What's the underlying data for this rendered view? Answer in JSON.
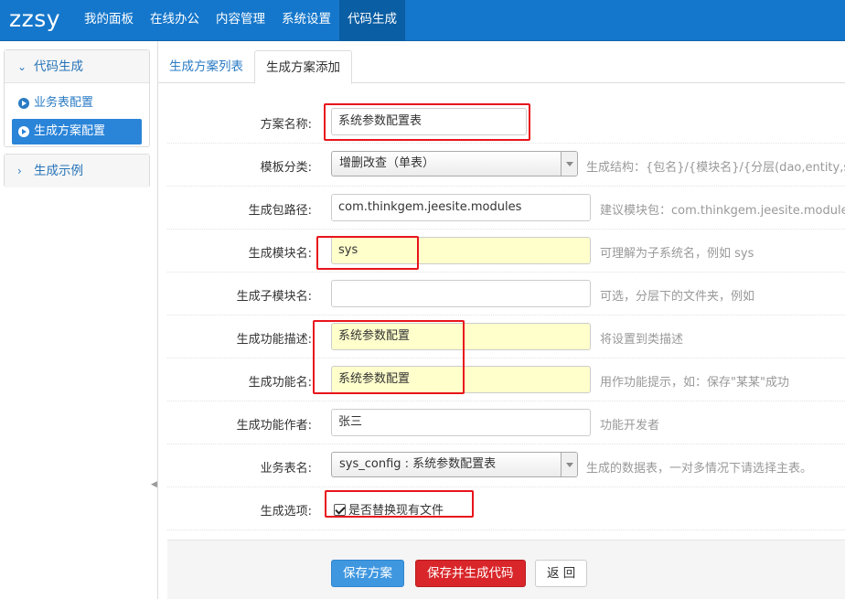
{
  "brand": "zzsy",
  "nav": [
    "我的面板",
    "在线办公",
    "内容管理",
    "系统设置",
    "代码生成"
  ],
  "sidebar": {
    "group1_title": "代码生成",
    "items": [
      "业务表配置",
      "生成方案配置"
    ],
    "group2_title": "生成示例"
  },
  "tabs": [
    "生成方案列表",
    "生成方案添加"
  ],
  "form": {
    "scheme_name": {
      "label": "方案名称:",
      "value": "系统参数配置表"
    },
    "template": {
      "label": "模板分类:",
      "value": "增删改查（单表）",
      "help": "生成结构：{包名}/{模块名}/{分层(dao,entity,service"
    },
    "package": {
      "label": "生成包路径:",
      "value": "com.thinkgem.jeesite.modules",
      "help": "建议模块包：com.thinkgem.jeesite.modules"
    },
    "module": {
      "label": "生成模块名:",
      "value": "sys",
      "help": "可理解为子系统名，例如 sys"
    },
    "sub_module": {
      "label": "生成子模块名:",
      "value": "",
      "help": "可选，分层下的文件夹，例如"
    },
    "function_desc": {
      "label": "生成功能描述:",
      "value": "系统参数配置",
      "help": "将设置到类描述"
    },
    "function_name": {
      "label": "生成功能名:",
      "value": "系统参数配置",
      "help": "用作功能提示，如：保存\"某某\"成功"
    },
    "author": {
      "label": "生成功能作者:",
      "value": "张三",
      "help": "功能开发者"
    },
    "table": {
      "label": "业务表名:",
      "value": "sys_config : 系统参数配置表",
      "help": "生成的数据表，一对多情况下请选择主表。"
    },
    "options": {
      "label": "生成选项:",
      "checkbox_label": "是否替换现有文件",
      "checked": true
    }
  },
  "buttons": {
    "save": "保存方案",
    "save_generate": "保存并生成代码",
    "back": "返 回"
  },
  "colors": {
    "nav_bg": "#1577cb",
    "highlight_border": "#e8141b",
    "field_highlight": "#ffffcc"
  }
}
